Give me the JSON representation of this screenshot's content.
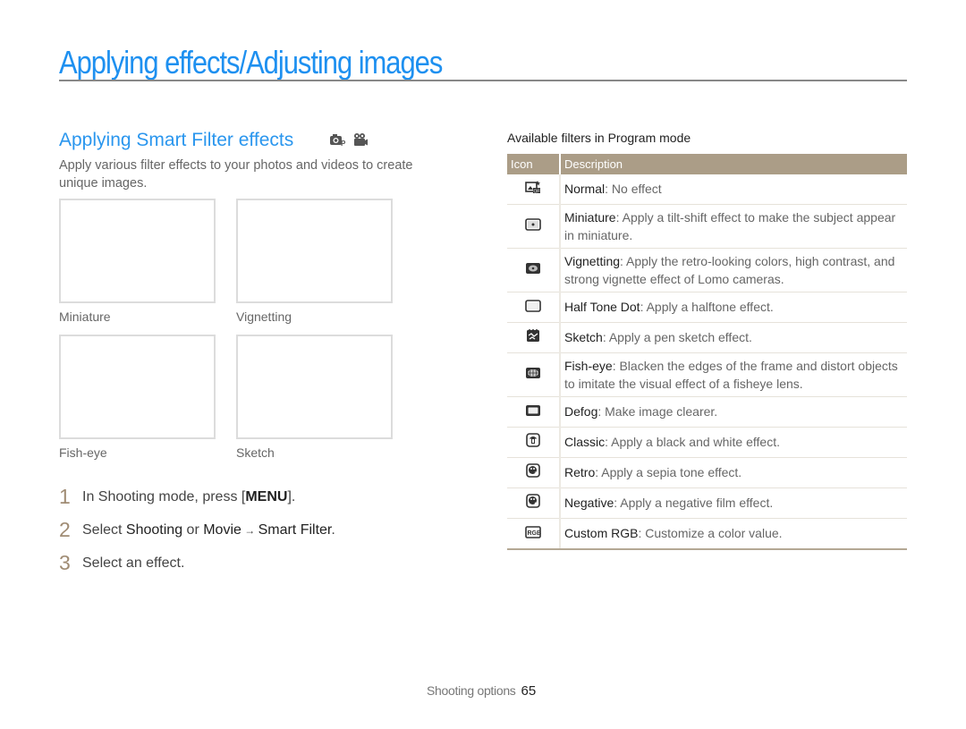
{
  "page": {
    "title": "Applying effects/Adjusting images"
  },
  "section": {
    "title": "Applying Smart Filter effects",
    "mode_icons": [
      "program-camera-icon",
      "movie-camera-icon"
    ],
    "intro": "Apply various filter effects to your photos and videos to create unique images."
  },
  "thumbnails": [
    {
      "label": "Miniature"
    },
    {
      "label": "Vignetting"
    },
    {
      "label": "Fish-eye"
    },
    {
      "label": "Sketch"
    }
  ],
  "steps": [
    {
      "number": "1",
      "pre": "In Shooting mode, press [",
      "bold1": "MENU",
      "mid": "].",
      "bold2": "",
      "post": ""
    },
    {
      "number": "2",
      "pre": "Select ",
      "bold1": "Shooting",
      "mid": " or ",
      "bold2": "Movie",
      "arrow": " → ",
      "bold3": "Smart Filter",
      "post": "."
    },
    {
      "number": "3",
      "pre": "Select an effect.",
      "bold1": "",
      "mid": "",
      "bold2": "",
      "post": ""
    }
  ],
  "table": {
    "caption": "Available filters in Program mode",
    "headers": {
      "icon": "Icon",
      "description": "Description"
    },
    "rows": [
      {
        "icon": "normal-off-icon",
        "name": "Normal",
        "desc": ": No effect"
      },
      {
        "icon": "miniature-icon",
        "name": "Miniature",
        "desc": ": Apply a tilt-shift effect to make the subject appear in miniature."
      },
      {
        "icon": "vignetting-icon",
        "name": "Vignetting",
        "desc": ": Apply the retro-looking colors, high contrast, and strong vignette effect of Lomo cameras."
      },
      {
        "icon": "half-tone-dot-icon",
        "name": "Half Tone Dot",
        "desc": ": Apply a halftone effect."
      },
      {
        "icon": "sketch-icon",
        "name": "Sketch",
        "desc": ": Apply a pen sketch effect."
      },
      {
        "icon": "fish-eye-icon",
        "name": "Fish-eye",
        "desc": ": Blacken the edges of the frame and distort objects to imitate the visual effect of a fisheye lens."
      },
      {
        "icon": "defog-icon",
        "name": "Defog",
        "desc": ": Make image clearer."
      },
      {
        "icon": "classic-icon",
        "name": "Classic",
        "desc": ": Apply a black and white effect."
      },
      {
        "icon": "retro-icon",
        "name": "Retro",
        "desc": ": Apply a sepia tone effect."
      },
      {
        "icon": "negative-icon",
        "name": "Negative",
        "desc": ": Apply a negative film effect."
      },
      {
        "icon": "custom-rgb-icon",
        "name": "Custom RGB",
        "desc": ": Customize a color value."
      }
    ]
  },
  "footer": {
    "section": "Shooting options",
    "page_number": "65"
  },
  "colors": {
    "title_blue": "#1e90f0",
    "header_tan": "#ab9d87",
    "step_number": "#a08c74"
  }
}
